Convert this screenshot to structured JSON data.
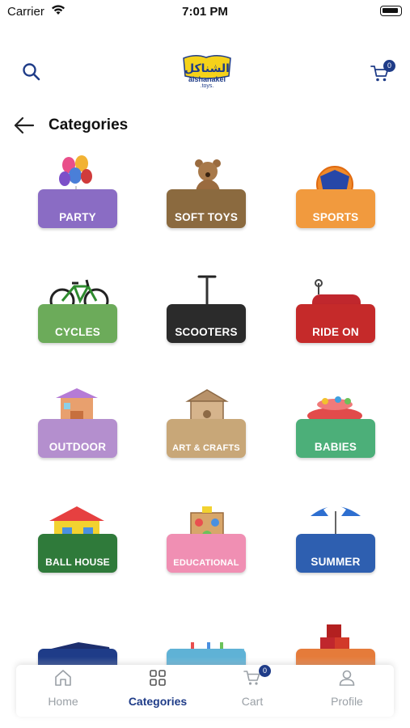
{
  "status_bar": {
    "carrier": "Carrier",
    "time": "7:01 PM"
  },
  "header": {
    "cart_count": "0",
    "logo_text": "alshanakel",
    "logo_sub": ".toys."
  },
  "page": {
    "title": "Categories"
  },
  "categories": [
    {
      "label": "PARTY",
      "color": "#8a6cc4",
      "icon": "balloons-icon"
    },
    {
      "label": "SOFT TOYS",
      "color": "#8b6a3f",
      "icon": "teddy-bear-icon"
    },
    {
      "label": "SPORTS",
      "color": "#f19a3e",
      "icon": "ball-icon"
    },
    {
      "label": "CYCLES",
      "color": "#6cab5a",
      "icon": "bicycle-icon"
    },
    {
      "label": "SCOOTERS",
      "color": "#2b2b2b",
      "icon": "scooter-icon"
    },
    {
      "label": "RIDE ON",
      "color": "#c52a2a",
      "icon": "ride-on-car-icon"
    },
    {
      "label": "OUTDOOR",
      "color": "#b48fce",
      "icon": "playhouse-icon"
    },
    {
      "label": "ART & CRAFTS",
      "color": "#c8a778",
      "icon": "wooden-house-icon"
    },
    {
      "label": "BABIES",
      "color": "#4caf79",
      "icon": "baby-walker-icon"
    },
    {
      "label": "BALL HOUSE",
      "color": "#2f7a3a",
      "icon": "ball-house-icon"
    },
    {
      "label": "EDUCATIONAL",
      "color": "#f08fb3",
      "icon": "activity-cube-icon"
    },
    {
      "label": "SUMMER",
      "color": "#2e5fb0",
      "icon": "beach-umbrella-icon"
    },
    {
      "label": "",
      "color": "#1f3c88",
      "icon": "race-car-icon"
    },
    {
      "label": "",
      "color": "#5fb2d6",
      "icon": "board-game-icon"
    },
    {
      "label": "",
      "color": "#e57b3a",
      "icon": "blocks-icon"
    }
  ],
  "tabbar": {
    "home": "Home",
    "categories": "Categories",
    "cart": "Cart",
    "cart_count": "0",
    "profile": "Profile"
  }
}
